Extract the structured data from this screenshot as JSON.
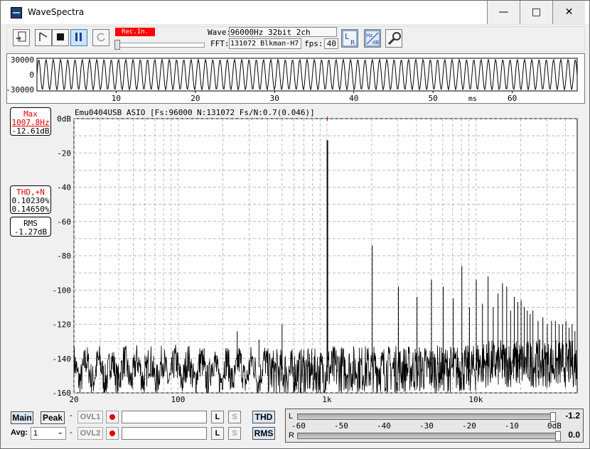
{
  "window": {
    "title": "WaveSpectra",
    "minimize": "—",
    "maximize": "□",
    "close": "✕"
  },
  "toolbar": {
    "rec_in": "Rec.In.",
    "wave_label": "Wave:",
    "wave_value": "96000Hz 32bit 2ch",
    "fft_label": "FFT:",
    "fft_value": "131072 Blkman-H7",
    "fps_label": "fps:",
    "fps_value": "40",
    "icons": [
      "record-file-icon",
      "play-icon",
      "stop-icon",
      "pause-icon",
      "refresh-icon",
      "lr-icon",
      "hz-db-icon",
      "wrench-icon"
    ],
    "lr_icon_text": "L R",
    "hzdb_icon_text": "Hz dB"
  },
  "waveform": {
    "y_ticks": [
      "30000",
      "0",
      "-30000"
    ],
    "x_ticks": [
      "10",
      "20",
      "30",
      "40",
      "50",
      "60"
    ],
    "x_unit": "ms"
  },
  "spectrum": {
    "header": "Emu0404USB ASIO   [Fs:96000 N:131072 Fs/N:0.7(0.046)]",
    "y_ticks": [
      "0dB",
      "-20",
      "-40",
      "-60",
      "-80",
      "-100",
      "-120",
      "-140",
      "-160"
    ],
    "x_ticks": [
      "20",
      "100",
      "1k",
      "10k"
    ],
    "max_label": "Max",
    "max_freq": "1007.8Hz",
    "max_level": "-12.61dB",
    "thd_label": "THD,+N",
    "thd_value": "0.10230%",
    "thdn_value": "0.14650%",
    "rms_label": "RMS",
    "rms_value": "-1.27dB",
    "grid": true,
    "x_scale": "log",
    "colors": {
      "trace": "#000000",
      "grid": "#9aa0c8",
      "marker": "#cc0000",
      "label_red": "#dd0000"
    }
  },
  "bottom": {
    "main_button": "Main",
    "peak_button": "Peak",
    "avg_label": "Avg:",
    "avg_value": "1",
    "ovl1": "OVL1",
    "ovl2": "OVL2",
    "l_button": "L",
    "s_button": "S",
    "thd_button": "THD",
    "rms_button": "RMS",
    "dash": "-",
    "meter": {
      "l_label": "L",
      "r_label": "R",
      "scale": [
        "-60",
        "-50",
        "-40",
        "-30",
        "-20",
        "-10",
        "0dB"
      ],
      "l_value": "-1.2",
      "r_value": "0.0",
      "l_level": 0.98,
      "r_level": 1.0
    }
  }
}
